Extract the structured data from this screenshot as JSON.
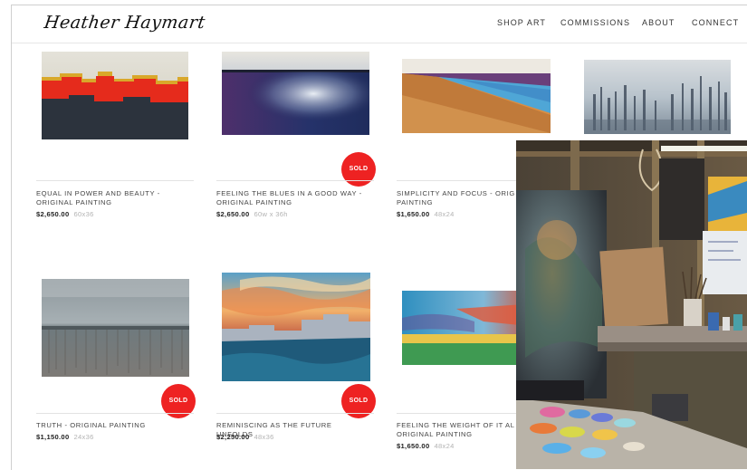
{
  "site": {
    "logo_text": "Heather Haymart"
  },
  "nav": {
    "items": [
      "SHOP ART",
      "COMMISSIONS",
      "ABOUT",
      "CONNECT"
    ]
  },
  "products": [
    {
      "title_line1": "EQUAL IN POWER AND BEAUTY -",
      "title_line2": "ORIGINAL PAINTING",
      "price": "$2,650.00",
      "size": "60x36",
      "sold": false
    },
    {
      "title_line1": "FEELING THE BLUES IN A GOOD WAY -",
      "title_line2": "ORIGINAL PAINTING",
      "price": "$2,650.00",
      "size": "60w x 36h",
      "sold": true
    },
    {
      "title_line1": "SIMPLICITY AND FOCUS - ORIG",
      "title_line2": "PAINTING",
      "price": "$1,650.00",
      "size": "48x24",
      "sold": false
    },
    {
      "title_line1": "TRUTH - ORIGINAL PAINTING",
      "title_line2": "",
      "price": "$1,150.00",
      "size": "24x36",
      "sold": true
    },
    {
      "title_line1": "REMINISCING AS THE FUTURE UNFOLDS",
      "title_line2": "",
      "price": "$2,250.00",
      "size": "48x36",
      "sold": true
    },
    {
      "title_line1": "FEELING THE WEIGHT OF IT AL",
      "title_line2": "ORIGINAL PAINTING",
      "price": "$1,650.00",
      "size": "48x24",
      "sold": false
    }
  ],
  "badges": {
    "sold_label": "SOLD"
  },
  "colors": {
    "sold_badge": "#ee2222",
    "text_primary": "#222222",
    "size_text": "#b3b3b3"
  }
}
